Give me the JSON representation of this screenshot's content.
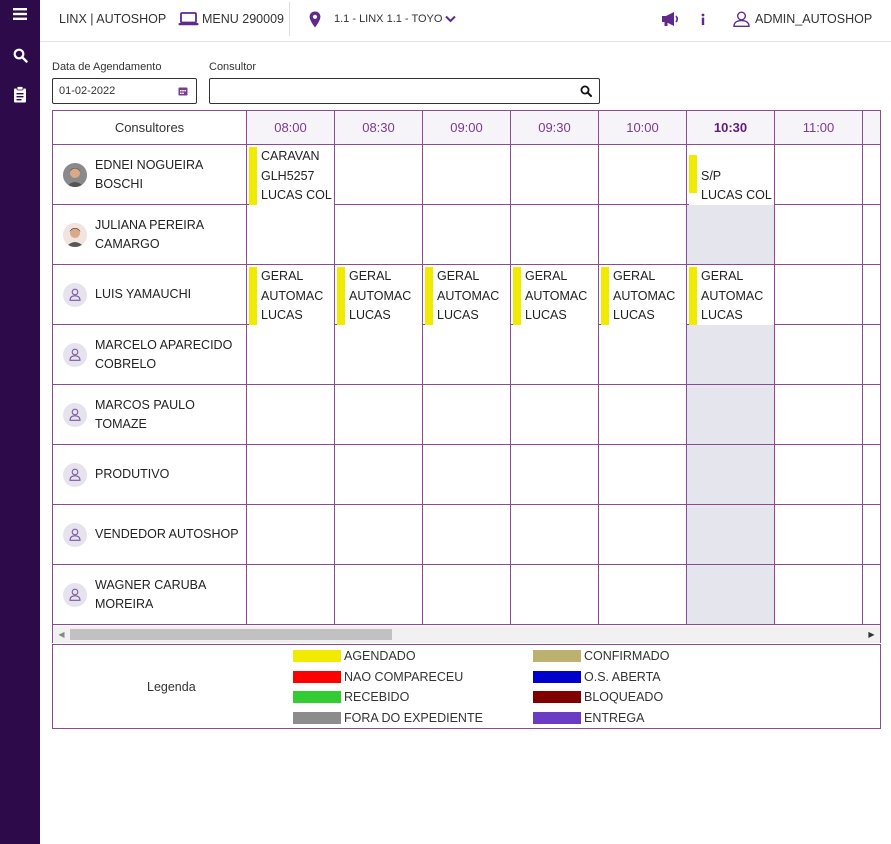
{
  "app": {
    "title": "LINX | AUTOSHOP",
    "menu_label": "MENU 290009",
    "location": "1.1 - LINX 1.1 - TOYO",
    "user": "ADMIN_AUTOSHOP"
  },
  "rail": {
    "items": [
      {
        "icon": "menu-icon"
      },
      {
        "icon": "search-icon"
      },
      {
        "icon": "clipboard-icon"
      }
    ]
  },
  "filters": {
    "date_label": "Data de Agendamento",
    "date_value": "01-02-2022",
    "consultant_label": "Consultor",
    "consultant_value": ""
  },
  "grid": {
    "consultants_header": "Consultores",
    "current_slot": "10:30",
    "time_slots": [
      "08:00",
      "08:30",
      "09:00",
      "09:30",
      "10:00",
      "10:30",
      "11:00"
    ],
    "consultants": [
      {
        "name": "EDNEI NOGUEIRA BOSCHI",
        "avatar": "photo"
      },
      {
        "name": "JULIANA PEREIRA CAMARGO",
        "avatar": "photo"
      },
      {
        "name": "LUIS YAMAUCHI",
        "avatar": "user-icon"
      },
      {
        "name": "MARCELO APARECIDO COBRELO",
        "avatar": "user-icon"
      },
      {
        "name": "MARCOS PAULO TOMAZE",
        "avatar": "user-icon"
      },
      {
        "name": "PRODUTIVO",
        "avatar": "user-icon"
      },
      {
        "name": "VENDEDOR AUTOSHOP",
        "avatar": "user-icon"
      },
      {
        "name": "WAGNER CARUBA MOREIRA",
        "avatar": "user-icon"
      }
    ],
    "appointments": [
      {
        "row": 0,
        "slot": 0,
        "status": "AGENDADO",
        "lines": [
          "CARAVAN",
          "GLH5257",
          "LUCAS COL"
        ]
      },
      {
        "row": 0,
        "slot": 5,
        "status": "AGENDADO",
        "lines": [
          "",
          "S/P",
          "LUCAS COL"
        ]
      },
      {
        "row": 2,
        "slot": 0,
        "status": "AGENDADO",
        "lines": [
          "GERAL",
          "AUTOMAC",
          "LUCAS"
        ]
      },
      {
        "row": 2,
        "slot": 1,
        "status": "AGENDADO",
        "lines": [
          "GERAL",
          "AUTOMAC",
          "LUCAS"
        ]
      },
      {
        "row": 2,
        "slot": 2,
        "status": "AGENDADO",
        "lines": [
          "GERAL",
          "AUTOMAC",
          "LUCAS"
        ]
      },
      {
        "row": 2,
        "slot": 3,
        "status": "AGENDADO",
        "lines": [
          "GERAL",
          "AUTOMAC",
          "LUCAS"
        ]
      },
      {
        "row": 2,
        "slot": 4,
        "status": "AGENDADO",
        "lines": [
          "GERAL",
          "AUTOMAC",
          "LUCAS"
        ]
      },
      {
        "row": 2,
        "slot": 5,
        "status": "AGENDADO",
        "lines": [
          "GERAL",
          "AUTOMAC",
          "LUCAS"
        ]
      }
    ]
  },
  "legend": {
    "title": "Legenda",
    "items": [
      {
        "label": "AGENDADO",
        "color": "#f2ea00"
      },
      {
        "label": "NAO COMPARECEU",
        "color": "#ff0000"
      },
      {
        "label": "RECEBIDO",
        "color": "#33cc33"
      },
      {
        "label": "FORA DO EXPEDIENTE",
        "color": "#8c8c8c"
      },
      {
        "label": "CONFIRMADO",
        "color": "#bdb16f"
      },
      {
        "label": "O.S. ABERTA",
        "color": "#0000cc"
      },
      {
        "label": "BLOQUEADO",
        "color": "#800000"
      },
      {
        "label": "ENTREGA",
        "color": "#6a3cc4"
      }
    ]
  },
  "colors": {
    "rail": "#2d0a4a",
    "accent": "#5f2a8a",
    "grid_border": "#8b4a92",
    "shaded_slot": "#e5e5ee"
  }
}
